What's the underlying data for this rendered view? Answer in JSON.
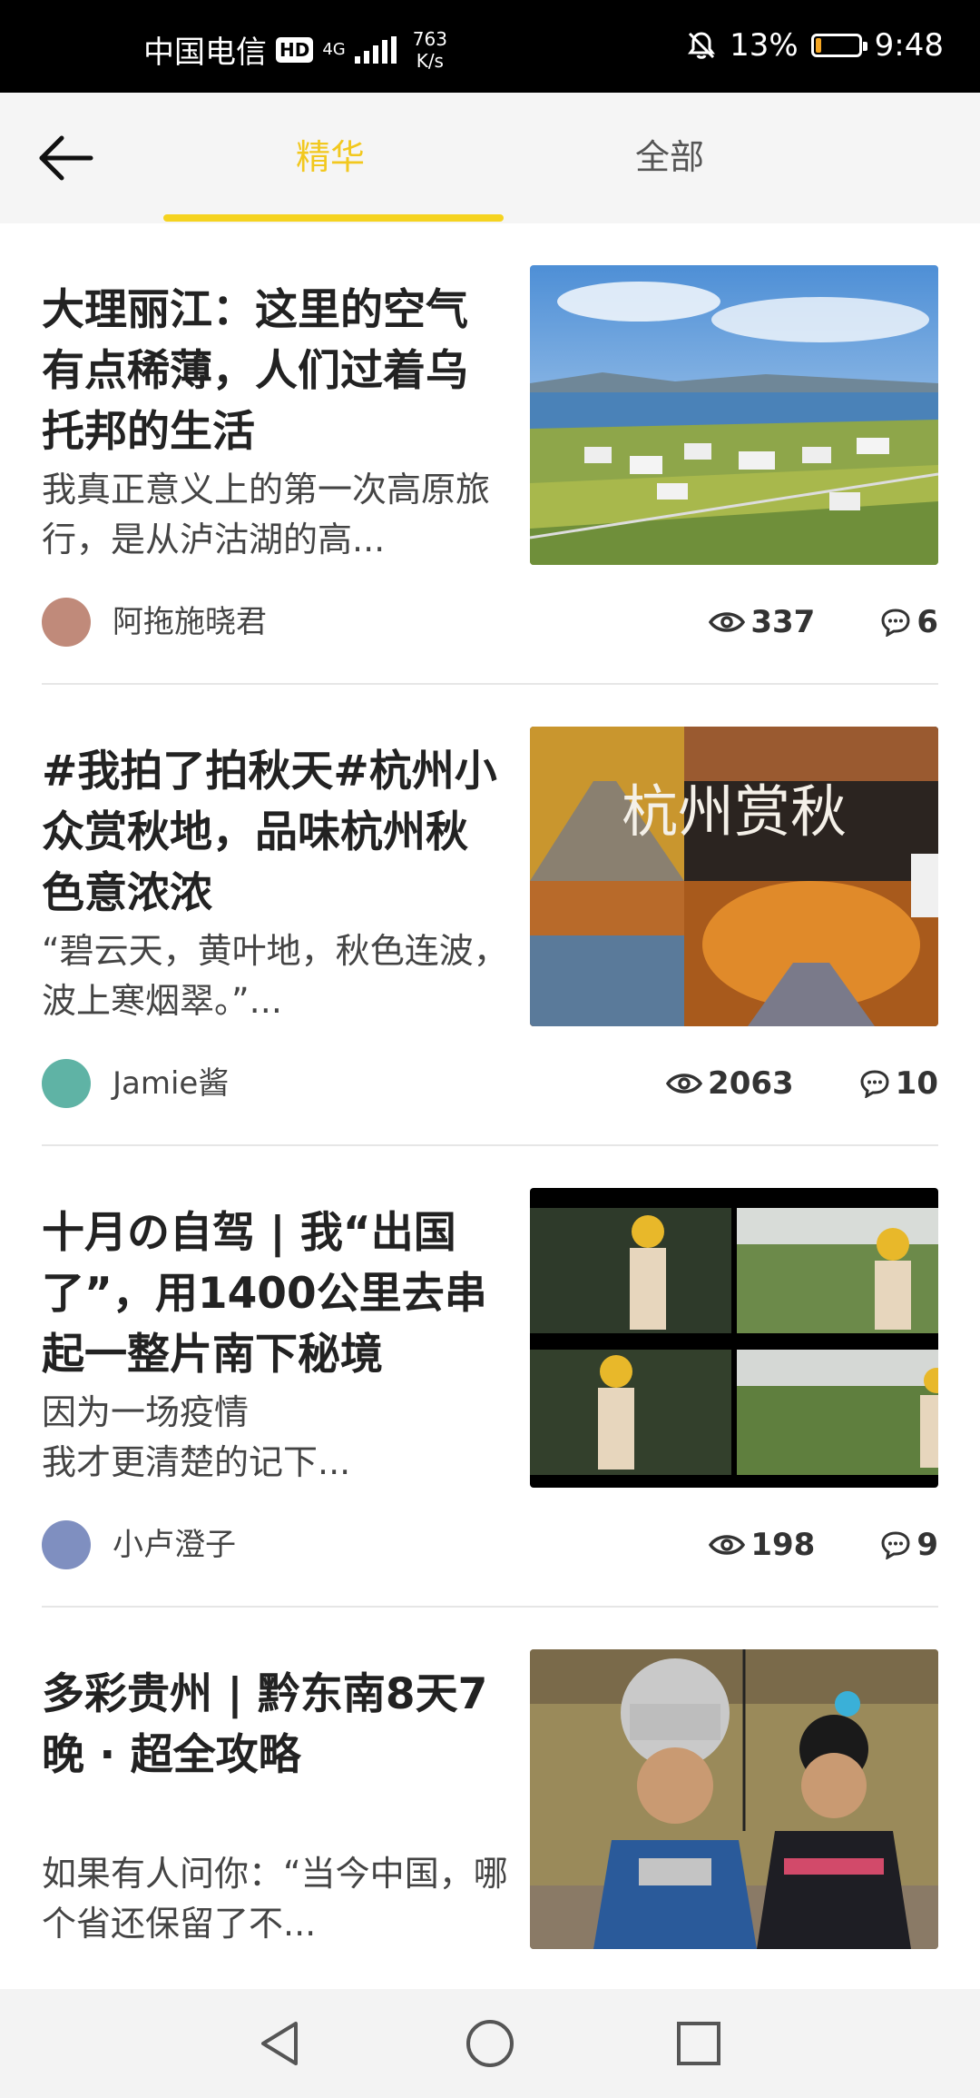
{
  "status_bar": {
    "carrier": "中国电信",
    "hd_badge": "HD",
    "network": "4G",
    "speed_value": "763",
    "speed_unit": "K/s",
    "battery": "13%",
    "battery_level": 0.13,
    "time": "9:48"
  },
  "header": {
    "tabs": [
      {
        "label": "精华",
        "active": true
      },
      {
        "label": "全部",
        "active": false
      }
    ],
    "accent_color": "#f5d320"
  },
  "articles": [
    {
      "title": "大理丽江：这里的空气有点稀薄，人们过着乌托邦的生活",
      "desc": "我真正意义上的第一次高原旅行，是从泸沽湖的高...",
      "author": "阿拖施晓君",
      "views": "337",
      "comments": "6"
    },
    {
      "title": "#我拍了拍秋天#杭州小众赏秋地，品味杭州秋色意浓浓",
      "desc": "“碧云天，黄叶地，秋色连波，波上寒烟翠。”...",
      "author": "Jamie酱",
      "views": "2063",
      "comments": "10",
      "image_text": "杭州赏秋"
    },
    {
      "title": "十月の自驾 | 我“出国了”，用1400公里去串起一整片南下秘境",
      "desc": "因为一场疫情\n我才更清楚的记下...",
      "author": "小卢澄子",
      "views": "198",
      "comments": "9"
    },
    {
      "title": "多彩贵州 | 黔东南8天7晚 · 超全攻略",
      "desc": "如果有人问你：“当今中国，哪个省还保留了不...",
      "author": "",
      "views": "",
      "comments": ""
    }
  ]
}
